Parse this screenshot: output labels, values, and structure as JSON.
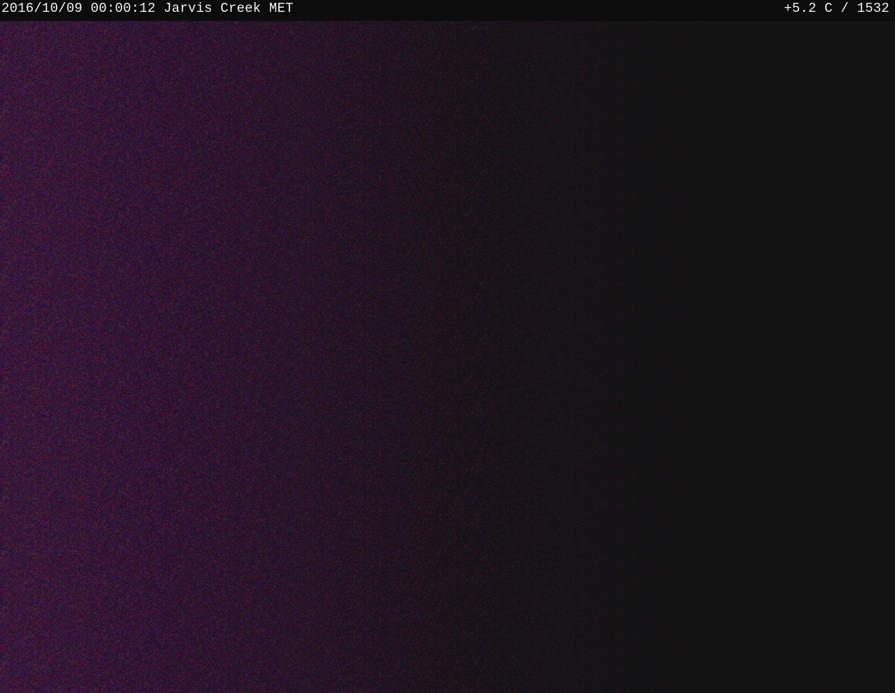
{
  "camera_overlay": {
    "timestamp": "2016/10/09 00:00:12",
    "location": "Jarvis Creek MET",
    "readout": "+5.2 C / 1532"
  },
  "scene": {
    "description_colors": {
      "background": "#121212",
      "left_tint": "#2a1230",
      "noise_red": "#8a2030",
      "noise_blue": "#30208a",
      "noise_green": "#206030"
    }
  }
}
